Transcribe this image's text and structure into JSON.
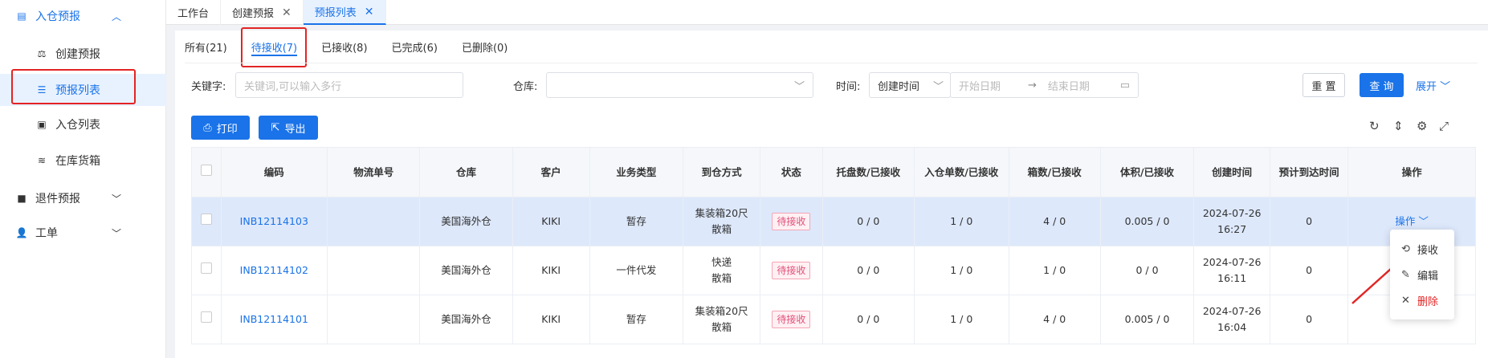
{
  "sidebar": {
    "group_inbound": "入仓预报",
    "items": [
      {
        "label": "创建预报"
      },
      {
        "label": "预报列表"
      },
      {
        "label": "入仓列表"
      },
      {
        "label": "在库货箱"
      }
    ],
    "group_return": "退件预报",
    "group_ticket": "工单"
  },
  "tabs": [
    {
      "label": "工作台"
    },
    {
      "label": "创建预报"
    },
    {
      "label": "预报列表"
    }
  ],
  "status_tabs": [
    {
      "label": "所有(21)"
    },
    {
      "label": "待接收(7)"
    },
    {
      "label": "已接收(8)"
    },
    {
      "label": "已完成(6)"
    },
    {
      "label": "已删除(0)"
    }
  ],
  "filters": {
    "keyword_label": "关键字:",
    "keyword_placeholder": "关键词,可以输入多行",
    "warehouse_label": "仓库:",
    "time_label": "时间:",
    "time_type": "创建时间",
    "start_placeholder": "开始日期",
    "end_placeholder": "结束日期",
    "reset": "重 置",
    "query": "查 询",
    "expand": "展开"
  },
  "toolbar": {
    "print": "打印",
    "export": "导出"
  },
  "table": {
    "headers": [
      "编码",
      "物流单号",
      "仓库",
      "客户",
      "业务类型",
      "到仓方式",
      "状态",
      "托盘数/已接收",
      "入仓单数/已接收",
      "箱数/已接收",
      "体积/已接收",
      "创建时间",
      "预计到达时间",
      "操作"
    ],
    "rows": [
      {
        "code": "INB12114103",
        "tracking": "",
        "warehouse": "美国海外仓",
        "customer": "KIKI",
        "biz": "暂存",
        "method_a": "集装箱20尺",
        "method_b": "散箱",
        "status": "待接收",
        "pallets": "0 / 0",
        "orders": "1 / 0",
        "boxes": "4 / 0",
        "volume": "0.005 / 0",
        "date": "2024-07-26",
        "time": "16:27",
        "eta": "0",
        "action": "操作"
      },
      {
        "code": "INB12114102",
        "tracking": "",
        "warehouse": "美国海外仓",
        "customer": "KIKI",
        "biz": "一件代发",
        "method_a": "快递",
        "method_b": "散箱",
        "status": "待接收",
        "pallets": "0 / 0",
        "orders": "1 / 0",
        "boxes": "1 / 0",
        "volume": "0 / 0",
        "date": "2024-07-26",
        "time": "16:11",
        "eta": "0",
        "action": ""
      },
      {
        "code": "INB12114101",
        "tracking": "",
        "warehouse": "美国海外仓",
        "customer": "KIKI",
        "biz": "暂存",
        "method_a": "集装箱20尺",
        "method_b": "散箱",
        "status": "待接收",
        "pallets": "0 / 0",
        "orders": "1 / 0",
        "boxes": "4 / 0",
        "volume": "0.005 / 0",
        "date": "2024-07-26",
        "time": "16:04",
        "eta": "0",
        "action": ""
      }
    ]
  },
  "dropdown": {
    "receive": "接收",
    "edit": "编辑",
    "delete": "删除"
  },
  "colors": {
    "accent": "#1a73e8",
    "highlight_box": "#e32424",
    "status_badge": "#e0507a"
  }
}
